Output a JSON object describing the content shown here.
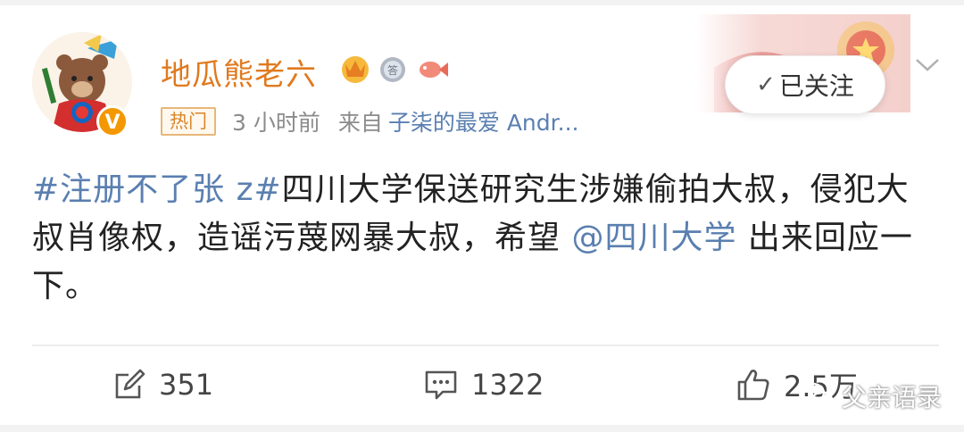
{
  "post": {
    "username": "地瓜熊老六",
    "verified_badge": "V",
    "hot_tag": "热门",
    "time": "3 小时前",
    "from_label": "来自",
    "client": "子柒的最爱 Andr...",
    "follow_check": "✓",
    "follow_label": "已关注",
    "content": {
      "topic": "#注册不了张 z#",
      "text_before_mention": "四川大学保送研究生涉嫌偷拍大叔，侵犯大叔肖像权，造谣污蔑网暴大叔，希望 ",
      "mention": "@四川大学",
      "text_after_mention": " 出来回应一下。"
    }
  },
  "actions": {
    "repost_count": "351",
    "comment_count": "1322",
    "like_count": "2.5万"
  },
  "watermark": {
    "text": "父亲语录"
  },
  "icons": [
    "edit-icon",
    "comment-icon",
    "like-icon",
    "chevron-down-icon",
    "crown-medal-icon",
    "answer-medal-icon",
    "fish-medal-icon",
    "wechat-icon"
  ],
  "colors": {
    "username": "#e07a1f",
    "link": "#5a7fb0",
    "meta": "#8b8b8b",
    "badge": "#f39800"
  }
}
